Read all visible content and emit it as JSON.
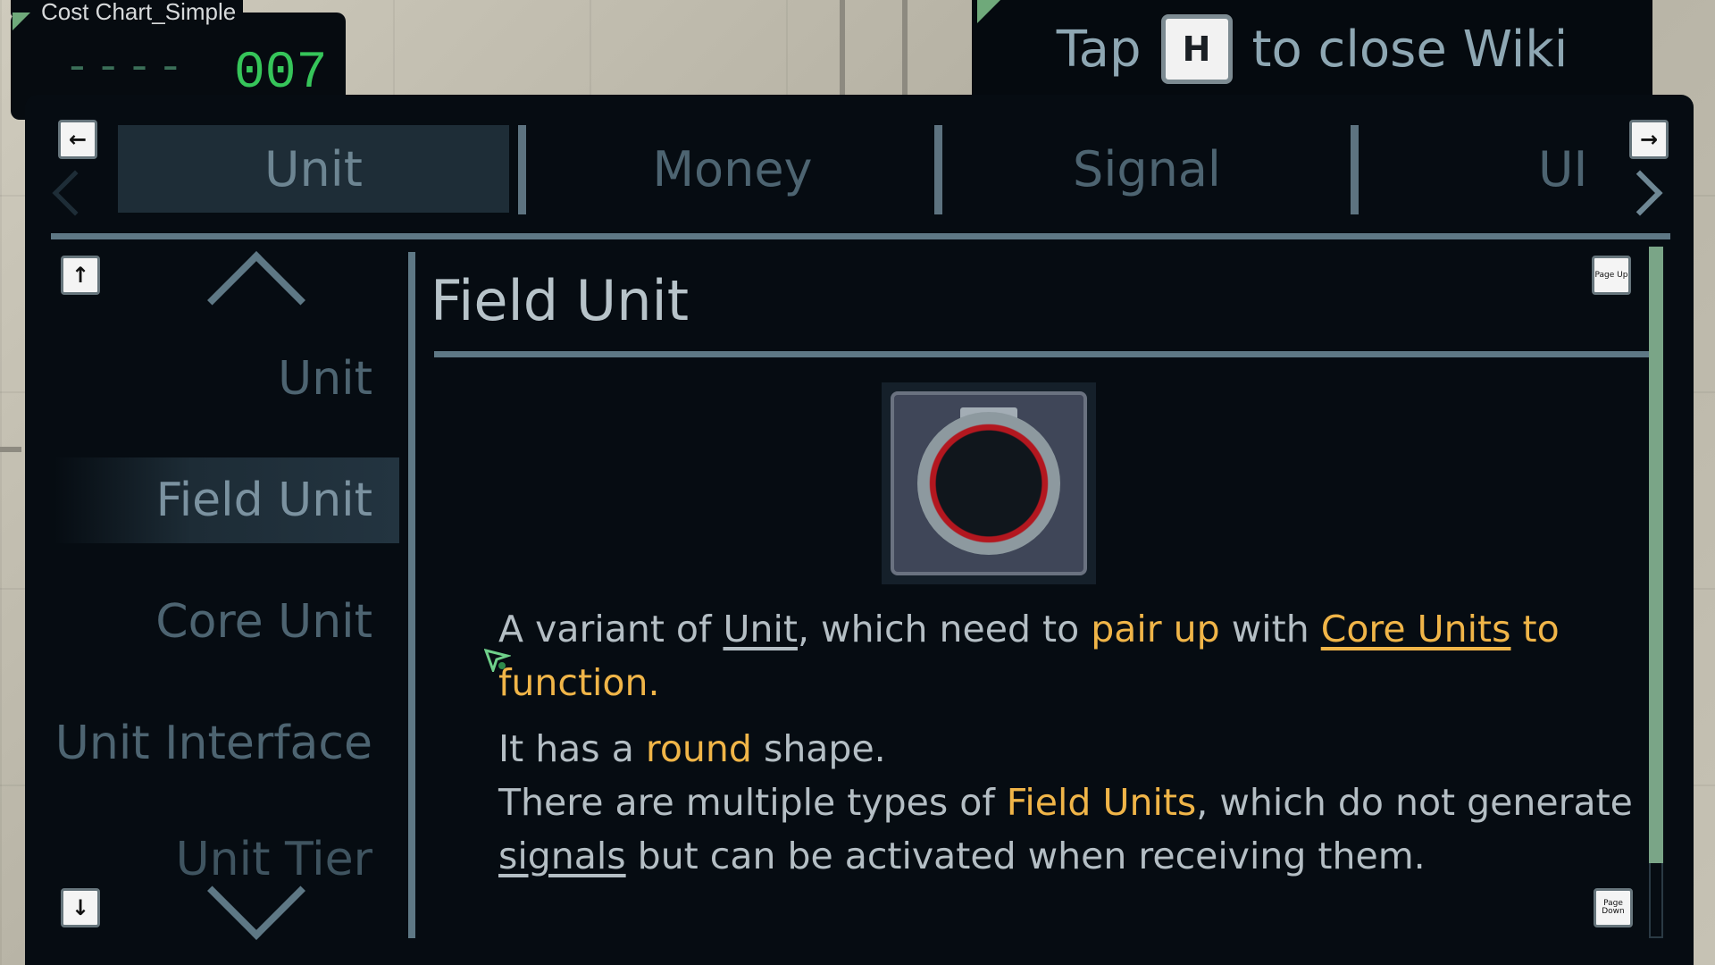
{
  "cost_chart": {
    "title": "Cost Chart_Simple",
    "placeholder": "----",
    "value": "007"
  },
  "hint": {
    "before": "Tap",
    "key": "H",
    "after": "to close Wiki"
  },
  "wiki": {
    "tabs": [
      {
        "label": "Unit",
        "active": true
      },
      {
        "label": "Money",
        "active": false
      },
      {
        "label": "Signal",
        "active": false
      },
      {
        "label": "UI",
        "active": false
      }
    ],
    "sidebar": {
      "items": [
        {
          "label": "Unit",
          "active": false
        },
        {
          "label": "Field Unit",
          "active": true
        },
        {
          "label": "Core Unit",
          "active": false
        },
        {
          "label": "Unit Interface",
          "active": false
        },
        {
          "label": "Unit Tier",
          "active": false
        }
      ]
    },
    "key_buttons": {
      "page_up": "Page Up",
      "page_down": "Page Down"
    },
    "article": {
      "title": "Field Unit",
      "p1": {
        "t1": "A variant of ",
        "link_unit": "Unit",
        "t2": ", which need to ",
        "hl_pair": "pair up",
        "t3": " with ",
        "link_core": "Core Units",
        "hl_to": " to",
        "hl_function": "function."
      },
      "p2": {
        "t1": "It has a ",
        "hl_round": "round",
        "t2": " shape."
      },
      "p3": {
        "t1": "There are multiple types of ",
        "hl_field": "Field Units",
        "t2": ", which do not generate",
        "link_signals": "signals",
        "t3": " but can be activated when receiving them."
      }
    }
  },
  "colors": {
    "panel_bg": "#060c12",
    "accent_highlight": "#f0b548",
    "divider": "#5e7885",
    "scrollbar": "#7aa587",
    "cost_value": "#36c55a"
  },
  "icons": {
    "tab_prev": "arrow-left-icon",
    "tab_next": "arrow-right-icon",
    "list_up": "arrow-up-icon",
    "list_down": "arrow-down-icon",
    "unit_image": "field-unit-icon"
  }
}
